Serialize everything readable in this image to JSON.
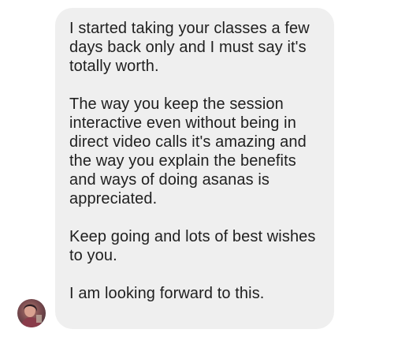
{
  "message": {
    "paragraphs": [
      "I started taking your classes a few days back only and I must say it's totally worth.",
      "The way you keep the session interactive even without being in direct video calls it's amazing and the way you explain the benefits and ways of doing asanas is appreciated.",
      "Keep going and lots of best wishes to you.",
      "I am looking forward to this."
    ],
    "bubble_color": "#efefef",
    "text_color": "#1f1f1f"
  },
  "sender": {
    "avatar_icon": "profile-photo"
  }
}
